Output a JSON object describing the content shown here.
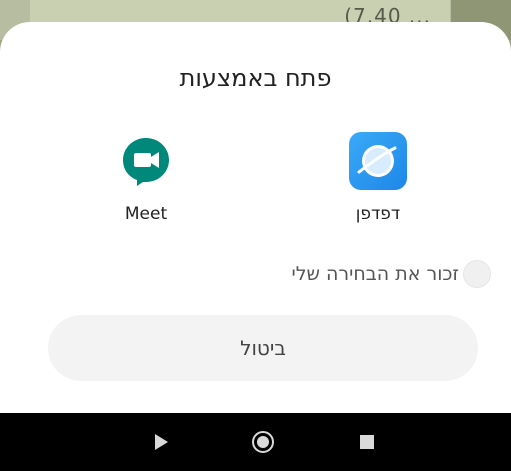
{
  "background": {
    "partial_text": "(7.40 ..."
  },
  "sheet": {
    "title": "פתח באמצעות",
    "apps": [
      {
        "label": "Meet",
        "icon": "google-meet-icon"
      },
      {
        "label": "דפדפן",
        "icon": "browser-icon"
      }
    ],
    "remember_label": "זכור את הבחירה שלי",
    "cancel_label": "ביטול"
  },
  "navbar": {
    "back_icon": "back-triangle-icon",
    "home_icon": "home-circle-icon",
    "recent_icon": "recents-square-icon"
  },
  "colors": {
    "browser_blue": "#2d9bf0",
    "meet_green": "#00897b",
    "sheet_bg": "#ffffff",
    "button_bg": "#f3f3f3",
    "navbar_bg": "#000000"
  }
}
